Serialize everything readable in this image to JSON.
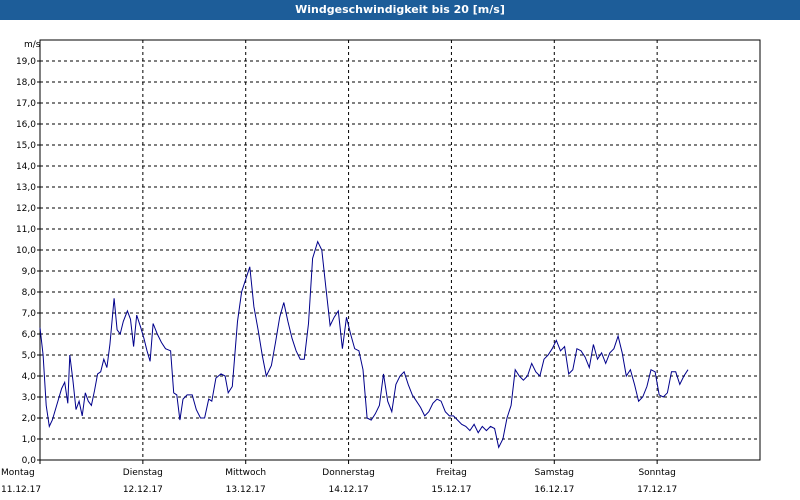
{
  "chart_data": {
    "type": "line",
    "title": "Windgeschwindigkeit bis 20 [m/s]",
    "ylabel": "m/s",
    "ylim": [
      0,
      20
    ],
    "yticks": [
      "0,0",
      "1,0",
      "2,0",
      "3,0",
      "4,0",
      "5,0",
      "6,0",
      "7,0",
      "8,0",
      "9,0",
      "10,0",
      "11,0",
      "12,0",
      "13,0",
      "14,0",
      "15,0",
      "16,0",
      "17,0",
      "18,0",
      "19,0"
    ],
    "grid": true,
    "xlim": [
      0,
      7
    ],
    "days": [
      {
        "day": "Montag",
        "date": "11.12.17"
      },
      {
        "day": "Dienstag",
        "date": "12.12.17"
      },
      {
        "day": "Mittwoch",
        "date": "13.12.17"
      },
      {
        "day": "Donnerstag",
        "date": "14.12.17"
      },
      {
        "day": "Freitag",
        "date": "15.12.17"
      },
      {
        "day": "Samstag",
        "date": "16.12.17"
      },
      {
        "day": "Sonntag",
        "date": "17.12.17"
      }
    ],
    "series": [
      {
        "color": "#00008b",
        "points": [
          [
            0.0,
            6.3
          ],
          [
            0.03,
            5.0
          ],
          [
            0.06,
            2.6
          ],
          [
            0.09,
            1.6
          ],
          [
            0.12,
            1.9
          ],
          [
            0.15,
            2.4
          ],
          [
            0.18,
            2.9
          ],
          [
            0.21,
            3.4
          ],
          [
            0.24,
            3.7
          ],
          [
            0.27,
            2.7
          ],
          [
            0.29,
            5.0
          ],
          [
            0.32,
            3.8
          ],
          [
            0.35,
            2.4
          ],
          [
            0.38,
            2.8
          ],
          [
            0.41,
            2.1
          ],
          [
            0.44,
            3.2
          ],
          [
            0.47,
            2.8
          ],
          [
            0.5,
            2.6
          ],
          [
            0.53,
            3.3
          ],
          [
            0.56,
            4.1
          ],
          [
            0.59,
            4.2
          ],
          [
            0.62,
            4.8
          ],
          [
            0.65,
            4.4
          ],
          [
            0.68,
            5.5
          ],
          [
            0.72,
            7.7
          ],
          [
            0.75,
            6.2
          ],
          [
            0.78,
            6.0
          ],
          [
            0.81,
            6.6
          ],
          [
            0.85,
            7.1
          ],
          [
            0.88,
            6.7
          ],
          [
            0.91,
            5.4
          ],
          [
            0.94,
            6.9
          ],
          [
            0.98,
            6.3
          ],
          [
            1.01,
            5.8
          ],
          [
            1.04,
            5.2
          ],
          [
            1.07,
            4.7
          ],
          [
            1.1,
            6.5
          ],
          [
            1.14,
            6.0
          ],
          [
            1.18,
            5.6
          ],
          [
            1.22,
            5.3
          ],
          [
            1.27,
            5.2
          ],
          [
            1.3,
            3.2
          ],
          [
            1.33,
            3.1
          ],
          [
            1.36,
            1.9
          ],
          [
            1.39,
            2.9
          ],
          [
            1.43,
            3.1
          ],
          [
            1.48,
            3.1
          ],
          [
            1.52,
            2.4
          ],
          [
            1.56,
            2.0
          ],
          [
            1.6,
            2.0
          ],
          [
            1.64,
            2.9
          ],
          [
            1.67,
            2.8
          ],
          [
            1.71,
            3.9
          ],
          [
            1.76,
            4.1
          ],
          [
            1.8,
            4.0
          ],
          [
            1.83,
            3.2
          ],
          [
            1.87,
            3.5
          ],
          [
            1.92,
            6.6
          ],
          [
            1.96,
            8.0
          ],
          [
            2.0,
            8.6
          ],
          [
            2.04,
            9.2
          ],
          [
            2.08,
            7.3
          ],
          [
            2.12,
            6.2
          ],
          [
            2.16,
            5.0
          ],
          [
            2.2,
            4.0
          ],
          [
            2.25,
            4.5
          ],
          [
            2.29,
            5.6
          ],
          [
            2.33,
            6.8
          ],
          [
            2.37,
            7.5
          ],
          [
            2.41,
            6.6
          ],
          [
            2.45,
            5.8
          ],
          [
            2.49,
            5.2
          ],
          [
            2.53,
            4.8
          ],
          [
            2.57,
            4.8
          ],
          [
            2.61,
            6.5
          ],
          [
            2.65,
            9.6
          ],
          [
            2.7,
            10.4
          ],
          [
            2.74,
            10.0
          ],
          [
            2.78,
            8.2
          ],
          [
            2.82,
            6.4
          ],
          [
            2.86,
            6.8
          ],
          [
            2.9,
            7.1
          ],
          [
            2.94,
            5.3
          ],
          [
            2.98,
            6.8
          ],
          [
            3.02,
            6.0
          ],
          [
            3.06,
            5.3
          ],
          [
            3.1,
            5.2
          ],
          [
            3.14,
            4.3
          ],
          [
            3.18,
            2.0
          ],
          [
            3.22,
            1.9
          ],
          [
            3.26,
            2.2
          ],
          [
            3.3,
            2.6
          ],
          [
            3.34,
            4.1
          ],
          [
            3.38,
            2.8
          ],
          [
            3.42,
            2.3
          ],
          [
            3.46,
            3.6
          ],
          [
            3.5,
            4.0
          ],
          [
            3.54,
            4.2
          ],
          [
            3.58,
            3.6
          ],
          [
            3.62,
            3.1
          ],
          [
            3.66,
            2.8
          ],
          [
            3.7,
            2.5
          ],
          [
            3.74,
            2.1
          ],
          [
            3.78,
            2.3
          ],
          [
            3.82,
            2.7
          ],
          [
            3.86,
            2.9
          ],
          [
            3.9,
            2.8
          ],
          [
            3.94,
            2.3
          ],
          [
            3.98,
            2.1
          ],
          [
            4.02,
            2.1
          ],
          [
            4.06,
            1.9
          ],
          [
            4.1,
            1.7
          ],
          [
            4.14,
            1.6
          ],
          [
            4.18,
            1.4
          ],
          [
            4.22,
            1.7
          ],
          [
            4.26,
            1.3
          ],
          [
            4.3,
            1.6
          ],
          [
            4.34,
            1.4
          ],
          [
            4.38,
            1.6
          ],
          [
            4.42,
            1.5
          ],
          [
            4.46,
            0.6
          ],
          [
            4.5,
            1.0
          ],
          [
            4.54,
            2.0
          ],
          [
            4.58,
            2.6
          ],
          [
            4.62,
            4.3
          ],
          [
            4.66,
            4.0
          ],
          [
            4.7,
            3.8
          ],
          [
            4.74,
            4.0
          ],
          [
            4.78,
            4.6
          ],
          [
            4.82,
            4.2
          ],
          [
            4.86,
            4.0
          ],
          [
            4.9,
            4.8
          ],
          [
            4.94,
            5.0
          ],
          [
            4.98,
            5.3
          ],
          [
            5.02,
            5.7
          ],
          [
            5.06,
            5.2
          ],
          [
            5.1,
            5.4
          ],
          [
            5.14,
            4.1
          ],
          [
            5.18,
            4.3
          ],
          [
            5.22,
            5.3
          ],
          [
            5.26,
            5.2
          ],
          [
            5.3,
            4.9
          ],
          [
            5.34,
            4.4
          ],
          [
            5.38,
            5.5
          ],
          [
            5.42,
            4.8
          ],
          [
            5.46,
            5.1
          ],
          [
            5.5,
            4.6
          ],
          [
            5.54,
            5.1
          ],
          [
            5.58,
            5.3
          ],
          [
            5.62,
            5.9
          ],
          [
            5.66,
            5.1
          ],
          [
            5.7,
            4.0
          ],
          [
            5.74,
            4.3
          ],
          [
            5.78,
            3.6
          ],
          [
            5.82,
            2.8
          ],
          [
            5.86,
            3.0
          ],
          [
            5.9,
            3.5
          ],
          [
            5.94,
            4.3
          ],
          [
            5.98,
            4.2
          ],
          [
            6.02,
            3.1
          ],
          [
            6.06,
            3.0
          ],
          [
            6.1,
            3.2
          ],
          [
            6.14,
            4.2
          ],
          [
            6.18,
            4.2
          ],
          [
            6.22,
            3.6
          ],
          [
            6.26,
            4.0
          ],
          [
            6.3,
            4.3
          ]
        ]
      }
    ]
  }
}
